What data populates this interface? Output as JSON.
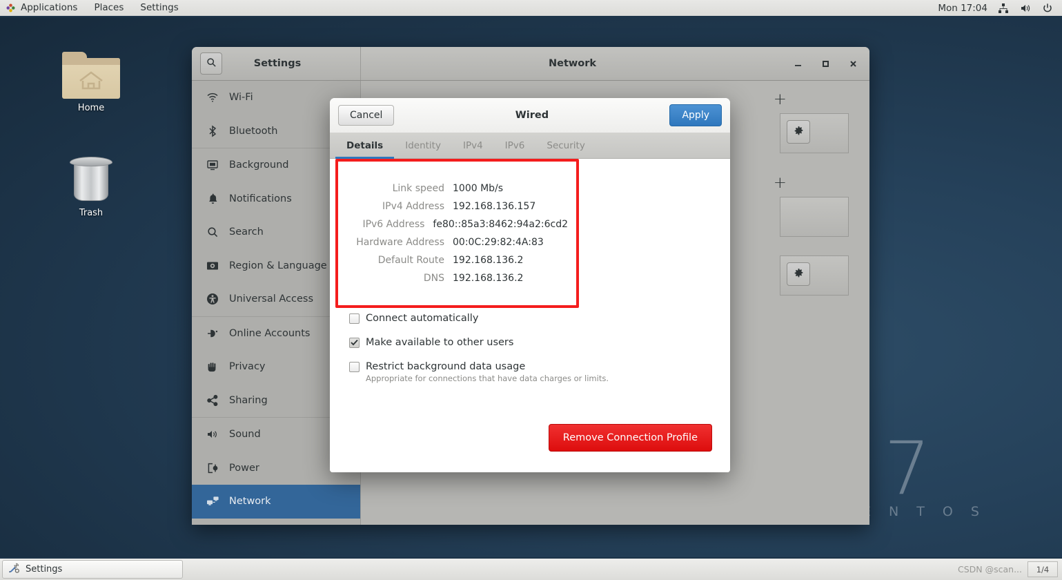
{
  "top_panel": {
    "menus": [
      {
        "label": "Applications",
        "icon": "applications-icon"
      },
      {
        "label": "Places",
        "icon": null
      },
      {
        "label": "Settings",
        "icon": null
      }
    ],
    "clock": "Mon 17:04",
    "tray": [
      "network-icon",
      "volume-icon",
      "power-icon"
    ]
  },
  "desktop": {
    "icons": [
      {
        "label": "Home",
        "icon": "home-folder-icon"
      },
      {
        "label": "Trash",
        "icon": "trash-icon"
      }
    ],
    "watermark": {
      "version": "7",
      "name": "C E N T O S"
    }
  },
  "settings_window": {
    "search_icon": "search-icon",
    "title": "Settings",
    "network_title": "Network",
    "window_controls": {
      "minimize": "–",
      "maximize": "☐",
      "close": "✕"
    },
    "sidebar": {
      "items": [
        {
          "label": "Wi-Fi",
          "icon": "wifi-icon",
          "selected": false
        },
        {
          "label": "Bluetooth",
          "icon": "bluetooth-icon",
          "selected": false
        },
        {
          "label": "Background",
          "icon": "background-icon",
          "selected": false
        },
        {
          "label": "Notifications",
          "icon": "bell-icon",
          "selected": false
        },
        {
          "label": "Search",
          "icon": "search-icon",
          "selected": false
        },
        {
          "label": "Region & Language",
          "icon": "region-icon",
          "selected": false
        },
        {
          "label": "Universal Access",
          "icon": "accessibility-icon",
          "selected": false
        },
        {
          "label": "Online Accounts",
          "icon": "online-accounts-icon",
          "selected": false
        },
        {
          "label": "Privacy",
          "icon": "privacy-hand-icon",
          "selected": false
        },
        {
          "label": "Sharing",
          "icon": "sharing-icon",
          "selected": false
        },
        {
          "label": "Sound",
          "icon": "sound-icon",
          "selected": false
        },
        {
          "label": "Power",
          "icon": "power-plug-icon",
          "selected": false
        },
        {
          "label": "Network",
          "icon": "network-icon",
          "selected": true
        }
      ]
    },
    "network_panel": {
      "add_label": "+",
      "gear_icon": "gear-icon"
    }
  },
  "wired_dialog": {
    "cancel_label": "Cancel",
    "title": "Wired",
    "apply_label": "Apply",
    "tabs": [
      {
        "label": "Details",
        "active": true
      },
      {
        "label": "Identity",
        "active": false
      },
      {
        "label": "IPv4",
        "active": false
      },
      {
        "label": "IPv6",
        "active": false
      },
      {
        "label": "Security",
        "active": false
      }
    ],
    "details": [
      {
        "key": "Link speed",
        "value": "1000 Mb/s"
      },
      {
        "key": "IPv4 Address",
        "value": "192.168.136.157"
      },
      {
        "key": "IPv6 Address",
        "value": "fe80::85a3:8462:94a2:6cd2"
      },
      {
        "key": "Hardware Address",
        "value": "00:0C:29:82:4A:83"
      },
      {
        "key": "Default Route",
        "value": "192.168.136.2"
      },
      {
        "key": "DNS",
        "value": "192.168.136.2"
      }
    ],
    "highlight_color": "#f41d1d",
    "checkboxes": [
      {
        "label": "Connect automatically",
        "checked": false,
        "sub": ""
      },
      {
        "label": "Make available to other users",
        "checked": true,
        "sub": ""
      },
      {
        "label": "Restrict background data usage",
        "checked": false,
        "sub": "Appropriate for connections that have data charges or limits."
      }
    ],
    "remove_label": "Remove Connection Profile",
    "remove_color": "#dd0d0d",
    "apply_color": "#2f77bd"
  },
  "bottom_panel": {
    "task": {
      "label": "Settings",
      "icon": "tools-icon"
    },
    "watermark": "CSDN @scan...",
    "workspace": "1/4"
  }
}
